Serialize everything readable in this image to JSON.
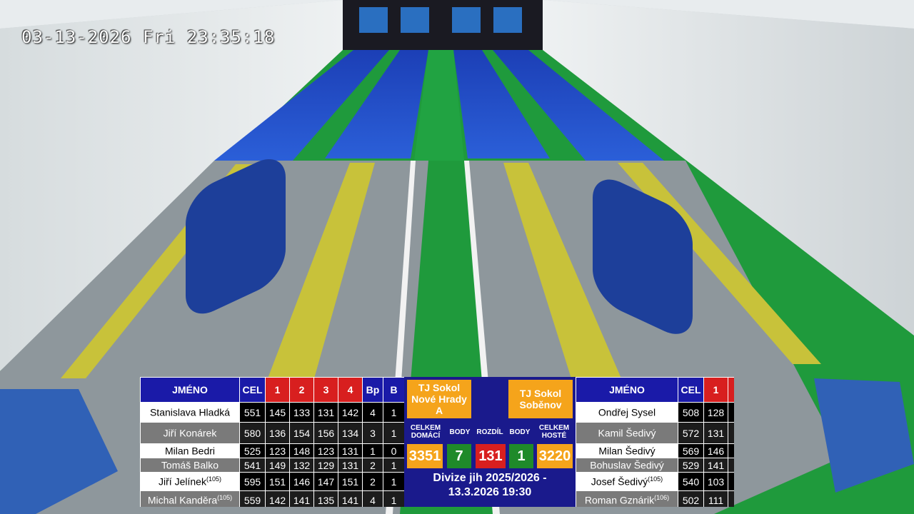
{
  "timestamp": "03-13-2026 Fri 23:35:18",
  "colors": {
    "board_bg": "#1a1a8c",
    "header_red": "#d81f1f",
    "team_orange": "#f5a41b",
    "score_green": "#1f8a2a",
    "diff_red": "#d81f1f"
  },
  "home": {
    "headers": {
      "name": "JMÉNO",
      "total": "CEL",
      "r1": "1",
      "r2": "2",
      "r3": "3",
      "r4": "4",
      "bp": "Bp",
      "b": "B"
    },
    "players": [
      {
        "name": "Stanislava Hladká",
        "sup": "",
        "total": "551",
        "r1": "145",
        "r2": "133",
        "r3": "131",
        "r4": "142",
        "bp": "4",
        "b": "1"
      },
      {
        "name": "Jiří Konárek",
        "sup": "",
        "total": "580",
        "r1": "136",
        "r2": "154",
        "r3": "156",
        "r4": "134",
        "bp": "3",
        "b": "1"
      },
      {
        "name": "Milan Bedri",
        "sup": "",
        "total": "525",
        "r1": "123",
        "r2": "148",
        "r3": "123",
        "r4": "131",
        "bp": "1",
        "b": "0"
      },
      {
        "name": "Tomáš Balko",
        "sup": "",
        "total": "541",
        "r1": "149",
        "r2": "132",
        "r3": "129",
        "r4": "131",
        "bp": "2",
        "b": "1"
      },
      {
        "name": "Jiří Jelínek",
        "sup": "(105)",
        "total": "595",
        "r1": "151",
        "r2": "146",
        "r3": "147",
        "r4": "151",
        "bp": "2",
        "b": "1"
      },
      {
        "name": "Michal Kanděra",
        "sup": "(105)",
        "total": "559",
        "r1": "142",
        "r2": "141",
        "r3": "135",
        "r4": "141",
        "bp": "4",
        "b": "1"
      }
    ]
  },
  "summary": {
    "home_team": "TJ Sokol Nové Hrady A",
    "guest_team": "TJ Sokol Soběnov",
    "label_home_total": "CELKEM DOMÁCÍ",
    "label_points": "BODY",
    "label_diff": "ROZDÍL",
    "label_guest_total": "CELKEM HOSTÉ",
    "home_total": "3351",
    "home_points": "7",
    "diff": "131",
    "guest_points": "1",
    "guest_total": "3220",
    "league": "Divize jih 2025/2026 -",
    "date": "13.3.2026 19:30"
  },
  "guest": {
    "headers": {
      "name": "JMÉNO",
      "total": "CEL",
      "r1": "1"
    },
    "players": [
      {
        "name": "Ondřej Sysel",
        "sup": "",
        "total": "508",
        "r1": "128"
      },
      {
        "name": "Kamil Šedivý",
        "sup": "",
        "total": "572",
        "r1": "131"
      },
      {
        "name": "Milan Šedivý",
        "sup": "",
        "total": "569",
        "r1": "146"
      },
      {
        "name": "Bohuslav Šedivý",
        "sup": "",
        "total": "529",
        "r1": "141"
      },
      {
        "name": "Josef Šedivý",
        "sup": "(105)",
        "total": "540",
        "r1": "103"
      },
      {
        "name": "Roman Gznárik",
        "sup": "(106)",
        "total": "502",
        "r1": "111"
      }
    ]
  }
}
